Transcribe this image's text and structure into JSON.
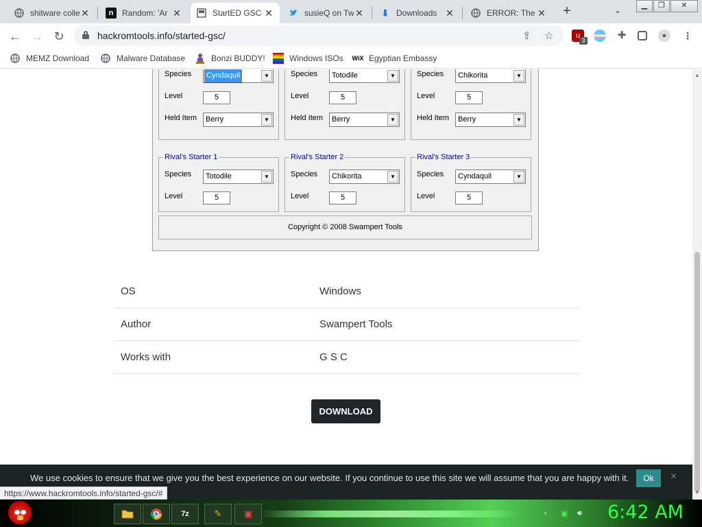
{
  "browser": {
    "tabs": [
      {
        "title": "shitware colle",
        "icon": "globe-icon"
      },
      {
        "title": "Random: 'Ar",
        "icon": "n-logo-icon"
      },
      {
        "title": "StartED GSC",
        "icon": "page-icon",
        "active": true
      },
      {
        "title": "susieQ on Tw",
        "icon": "twitter-bird-icon"
      },
      {
        "title": "Downloads",
        "icon": "download-arrow-icon"
      },
      {
        "title": "ERROR: The",
        "icon": "globe-icon"
      }
    ],
    "url": "hackromtools.info/started-gsc/",
    "extension_badge": "3",
    "bookmarks": [
      {
        "label": "MEMZ Download",
        "icon": "globe-icon"
      },
      {
        "label": "Malware Database",
        "icon": "globe-icon"
      },
      {
        "label": "Bonzi BUDDY!",
        "icon": "bonzi-icon"
      },
      {
        "label": "Windows ISOs",
        "icon": "rainbow-flag-icon"
      },
      {
        "label": "Egyptian Embassy",
        "icon": "wix-icon"
      }
    ],
    "status_url": "https://www.hackromtools.info/started-gsc/#"
  },
  "editor": {
    "player_starters": [
      {
        "species_label": "Species",
        "species": "Cyndaquil",
        "selected": true,
        "level_label": "Level",
        "level": "5",
        "item_label": "Held Item",
        "item": "Berry"
      },
      {
        "species_label": "Species",
        "species": "Totodile",
        "level_label": "Level",
        "level": "5",
        "item_label": "Held Item",
        "item": "Berry"
      },
      {
        "species_label": "Species",
        "species": "Chikorita",
        "level_label": "Level",
        "level": "5",
        "item_label": "Held Item",
        "item": "Berry"
      }
    ],
    "rival_starters": [
      {
        "legend": "Rival's Starter 1",
        "species_label": "Species",
        "species": "Totodile",
        "level_label": "Level",
        "level": "5"
      },
      {
        "legend": "Rival's Starter 2",
        "species_label": "Species",
        "species": "Chikorita",
        "level_label": "Level",
        "level": "5"
      },
      {
        "legend": "Rival's Starter 3",
        "species_label": "Species",
        "species": "Cyndaquil",
        "level_label": "Level",
        "level": "5"
      }
    ],
    "copyright": "Copyright © 2008 Swampert Tools"
  },
  "info": [
    {
      "key": "OS",
      "value": "Windows"
    },
    {
      "key": "Author",
      "value": "Swampert Tools"
    },
    {
      "key": "Works with",
      "value": "G S C"
    }
  ],
  "download_label": "DOWNLOAD",
  "cookie": {
    "message": "We use cookies to ensure that we give you the best experience on our website. If you continue to use this site we will assume that you are happy with it.",
    "ok": "Ok",
    "close": "×"
  },
  "taskbar": {
    "clock": "6:42 AM",
    "apps": [
      "folder-icon",
      "chrome-icon",
      "7zip-icon",
      "paint-icon",
      "video-icon"
    ]
  },
  "colors": {
    "legend": "#0000aa",
    "clock": "#2bff4a",
    "selection": "#3399ff"
  }
}
